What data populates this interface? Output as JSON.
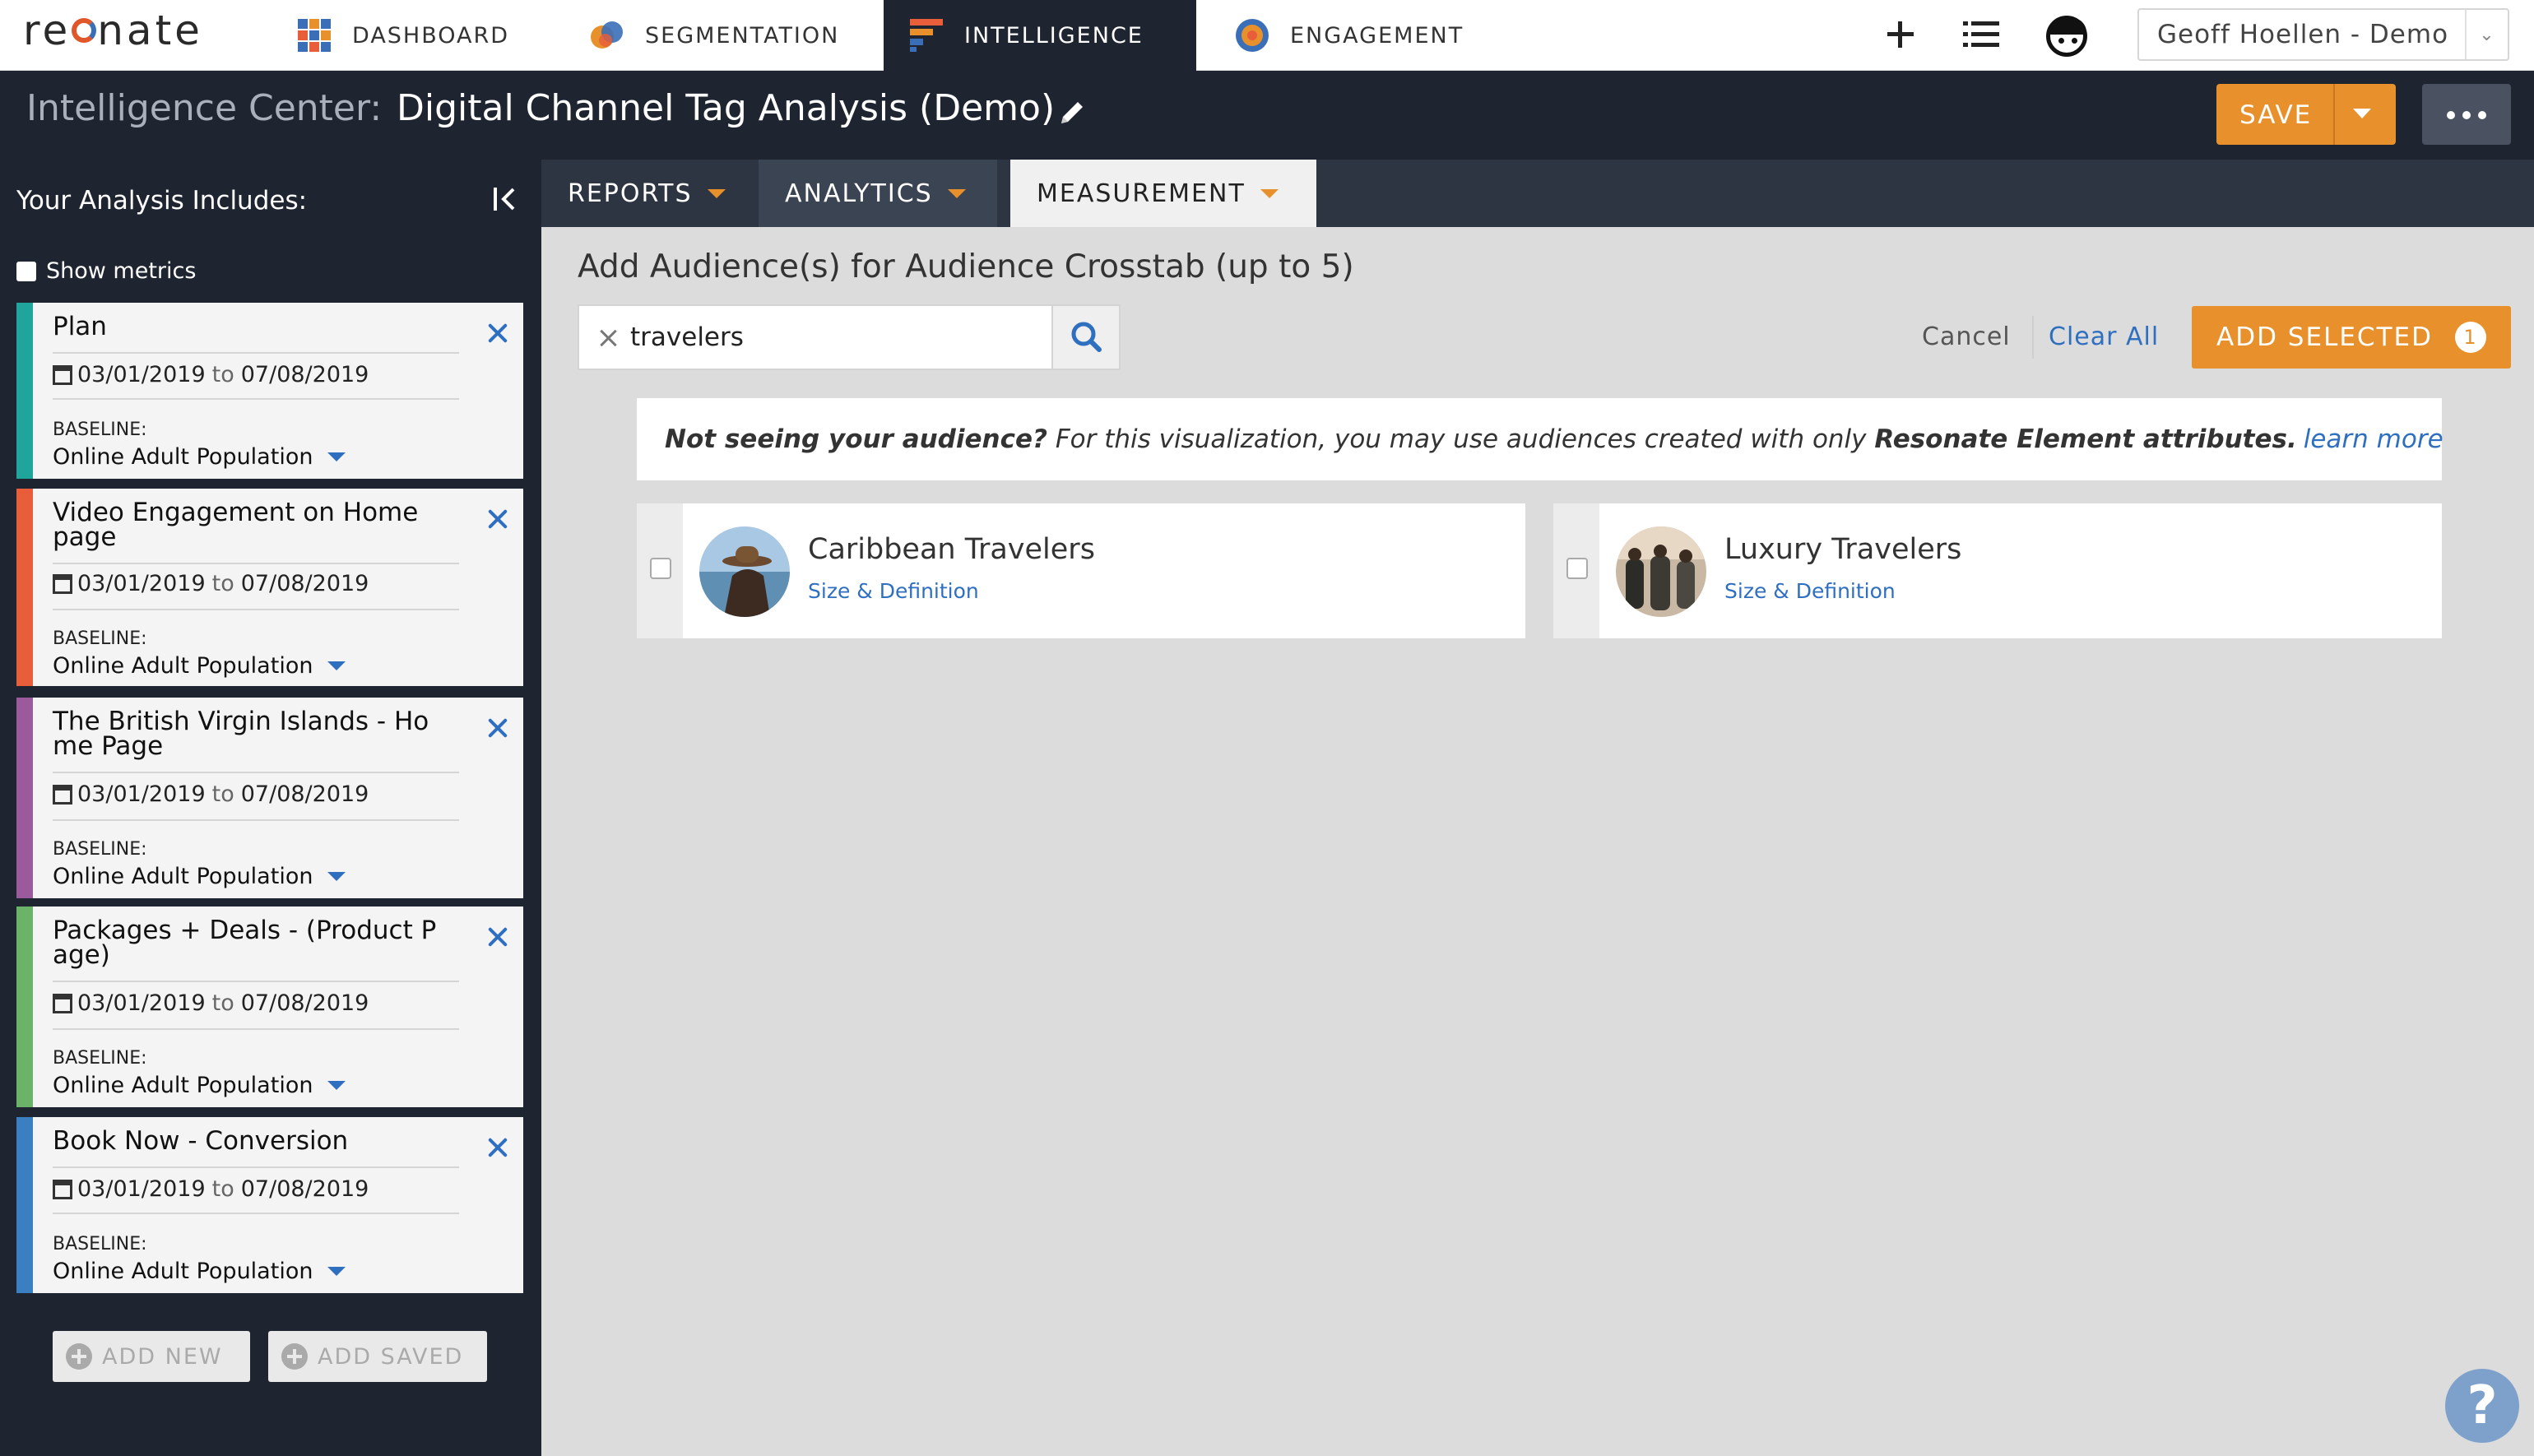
{
  "brand": {
    "logo_prefix": "re",
    "logo_suffix": "nate"
  },
  "nav": {
    "tabs": [
      {
        "label": "DASHBOARD",
        "icon": "dashboard-grid-icon"
      },
      {
        "label": "SEGMENTATION",
        "icon": "segmentation-circles-icon"
      },
      {
        "label": "INTELLIGENCE",
        "icon": "intelligence-bars-icon",
        "active": true
      },
      {
        "label": "ENGAGEMENT",
        "icon": "engagement-target-icon"
      }
    ],
    "user": "Geoff Hoellen - Demo"
  },
  "header": {
    "section": "Intelligence Center:",
    "title": "Digital Channel Tag Analysis (Demo)",
    "save_label": "SAVE"
  },
  "sidebar": {
    "heading": "Your Analysis Includes:",
    "show_metrics_label": "Show metrics",
    "date_to": "to",
    "baseline_label": "BASELINE:",
    "cards": [
      {
        "title": "Plan",
        "start": "03/01/2019",
        "end": "07/08/2019",
        "baseline": "Online Adult Population",
        "color": "#1fa59b"
      },
      {
        "title": "Video Engagement on Home page",
        "start": "03/01/2019",
        "end": "07/08/2019",
        "baseline": "Online Adult Population",
        "color": "#e85d3a"
      },
      {
        "title": "The British Virgin Islands - Ho me Page",
        "start": "03/01/2019",
        "end": "07/08/2019",
        "baseline": "Online Adult Population",
        "color": "#9b5a9b"
      },
      {
        "title": "Packages + Deals - (Product P age)",
        "start": "03/01/2019",
        "end": "07/08/2019",
        "baseline": "Online Adult Population",
        "color": "#6cb36a"
      },
      {
        "title": "Book Now - Conversion",
        "start": "03/01/2019",
        "end": "07/08/2019",
        "baseline": "Online Adult Population",
        "color": "#3a7fc0"
      }
    ],
    "add_new_label": "ADD NEW",
    "add_saved_label": "ADD SAVED"
  },
  "subtabs": [
    {
      "label": "REPORTS"
    },
    {
      "label": "ANALYTICS"
    },
    {
      "label": "MEASUREMENT",
      "active": true
    }
  ],
  "main": {
    "title": "Add Audience(s) for Audience Crosstab (up to 5)",
    "search_value": "travelers",
    "cancel_label": "Cancel",
    "clear_label": "Clear All",
    "add_selected_label": "ADD SELECTED",
    "selected_count": "1",
    "notice": {
      "lead": "Not seeing your audience?",
      "body": " For this visualization, you may use audiences created with only ",
      "bold": "Resonate Element attributes.",
      "link": "learn more"
    },
    "audiences": [
      {
        "name": "Caribbean Travelers",
        "link": "Size & Definition",
        "checked": false
      },
      {
        "name": "Luxury Travelers",
        "link": "Size & Definition",
        "checked": false
      }
    ]
  },
  "help_label": "?",
  "colors": {
    "accent": "#e8912c",
    "navy": "#1e2530",
    "link": "#2f6fc0"
  }
}
